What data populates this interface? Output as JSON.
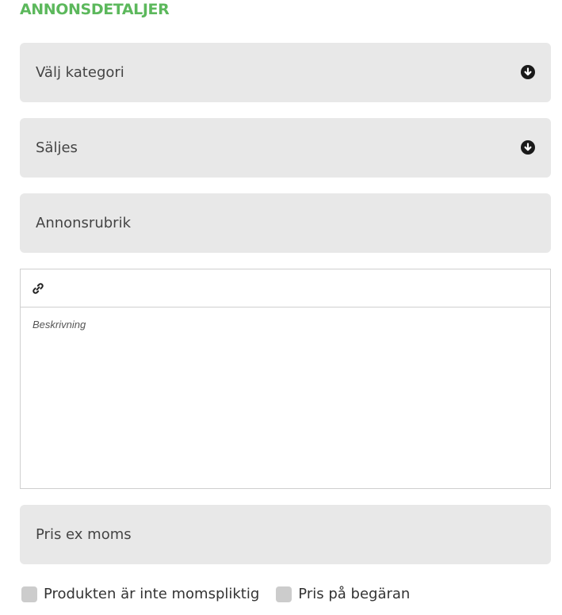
{
  "section": {
    "title": "ANNONSDETALJER",
    "accent_color": "#5cb85c"
  },
  "form": {
    "category": {
      "placeholder": "Välj kategori",
      "icon": "circle-arrow-down-icon"
    },
    "listing_type": {
      "value": "Säljes",
      "icon": "circle-arrow-down-icon"
    },
    "ad_title": {
      "placeholder": "Annonsrubrik"
    },
    "description": {
      "toolbar_icon": "link-icon",
      "placeholder": "Beskrivning"
    },
    "price": {
      "placeholder": "Pris ex moms"
    },
    "checkboxes": [
      {
        "label": "Produkten är inte momspliktig",
        "checked": false
      },
      {
        "label": "Pris på begäran",
        "checked": false
      }
    ]
  }
}
